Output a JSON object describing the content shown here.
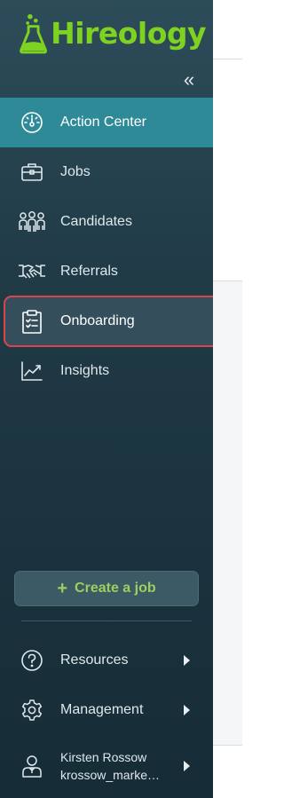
{
  "brand": {
    "name": "Hireology",
    "color": "#7ed321"
  },
  "sidebar": {
    "collapse_icon": "double-chevron-left",
    "collapse_glyph": "«",
    "items": [
      {
        "label": "Action Center",
        "icon": "speedometer-icon",
        "active": true
      },
      {
        "label": "Jobs",
        "icon": "briefcase-icon",
        "active": false
      },
      {
        "label": "Candidates",
        "icon": "people-group-icon",
        "active": false
      },
      {
        "label": "Referrals",
        "icon": "handshake-icon",
        "active": false
      },
      {
        "label": "Onboarding",
        "icon": "clipboard-checklist-icon",
        "active": false,
        "highlighted": true
      },
      {
        "label": "Insights",
        "icon": "trend-chart-icon",
        "active": false
      }
    ],
    "create_job": {
      "plus": "+",
      "label": "Create a job"
    },
    "bottom": {
      "resources": {
        "label": "Resources",
        "icon": "question-circle-icon"
      },
      "management": {
        "label": "Management",
        "icon": "gear-icon"
      },
      "user": {
        "name": "Kirsten Rossow",
        "handle": "krossow_marke…",
        "icon": "user-avatar-icon"
      }
    }
  },
  "colors": {
    "active_item": "#2d8a96",
    "highlight_border": "#d9454e",
    "create_button_text": "#9ccf5b"
  }
}
